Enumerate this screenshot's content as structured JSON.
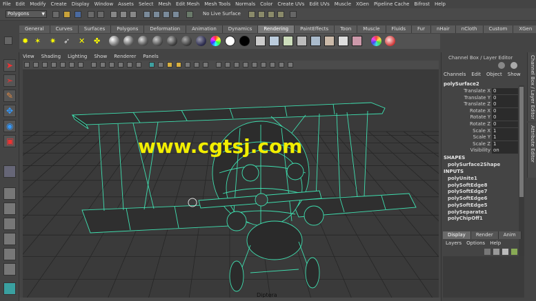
{
  "menubar": {
    "items": [
      "File",
      "Edit",
      "Modify",
      "Create",
      "Display",
      "Window",
      "Assets",
      "Select",
      "Mesh",
      "Edit Mesh",
      "Mesh Tools",
      "Normals",
      "Color",
      "Create UVs",
      "Edit UVs",
      "Muscle",
      "XGen",
      "Pipeline Cache",
      "Bifrost",
      "Help"
    ]
  },
  "statusline": {
    "mode": "Polygons",
    "live_surface": "No Live Surface"
  },
  "shelf": {
    "tabs": [
      "General",
      "Curves",
      "Surfaces",
      "Polygons",
      "Deformation",
      "Animation",
      "Dynamics",
      "Rendering",
      "PaintEffects",
      "Toon",
      "Muscle",
      "Fluids",
      "Fur",
      "nHair",
      "nCloth",
      "Custom",
      "XGen"
    ],
    "active_tab": "Rendering"
  },
  "panel": {
    "menu": [
      "View",
      "Shading",
      "Lighting",
      "Show",
      "Renderer",
      "Panels"
    ],
    "camera_label": "Diptera"
  },
  "watermark": "www.cgtsj.com",
  "channel_box": {
    "title": "Channel Box / Layer Editor",
    "menu": [
      "Channels",
      "Edit",
      "Object",
      "Show"
    ],
    "object": "polySurface2",
    "attributes": [
      {
        "name": "Translate X",
        "value": "0"
      },
      {
        "name": "Translate Y",
        "value": "0"
      },
      {
        "name": "Translate Z",
        "value": "0"
      },
      {
        "name": "Rotate X",
        "value": "0"
      },
      {
        "name": "Rotate Y",
        "value": "0"
      },
      {
        "name": "Rotate Z",
        "value": "0"
      },
      {
        "name": "Scale X",
        "value": "1"
      },
      {
        "name": "Scale Y",
        "value": "1"
      },
      {
        "name": "Scale Z",
        "value": "1"
      },
      {
        "name": "Visibility",
        "value": "on"
      }
    ],
    "shapes_header": "SHAPES",
    "shape": "polySurface2Shape",
    "inputs_header": "INPUTS",
    "inputs": [
      "polyUnite1",
      "polySoftEdge8",
      "polySoftEdge7",
      "polySoftEdge6",
      "polySoftEdge5",
      "polySeparate1",
      "polyChipOff1"
    ]
  },
  "layer_editor": {
    "tabs": [
      "Display",
      "Render",
      "Anim"
    ],
    "active_tab": "Display",
    "menu": [
      "Layers",
      "Options",
      "Help"
    ]
  },
  "side_tabs": [
    "Channel Box / Layer Editor",
    "Attribute Editor"
  ],
  "colors": {
    "wire": "#3fe0b0",
    "watermark": "#f2ee00",
    "viewport_bg": "#3a3a3a",
    "grid": "#262626"
  }
}
